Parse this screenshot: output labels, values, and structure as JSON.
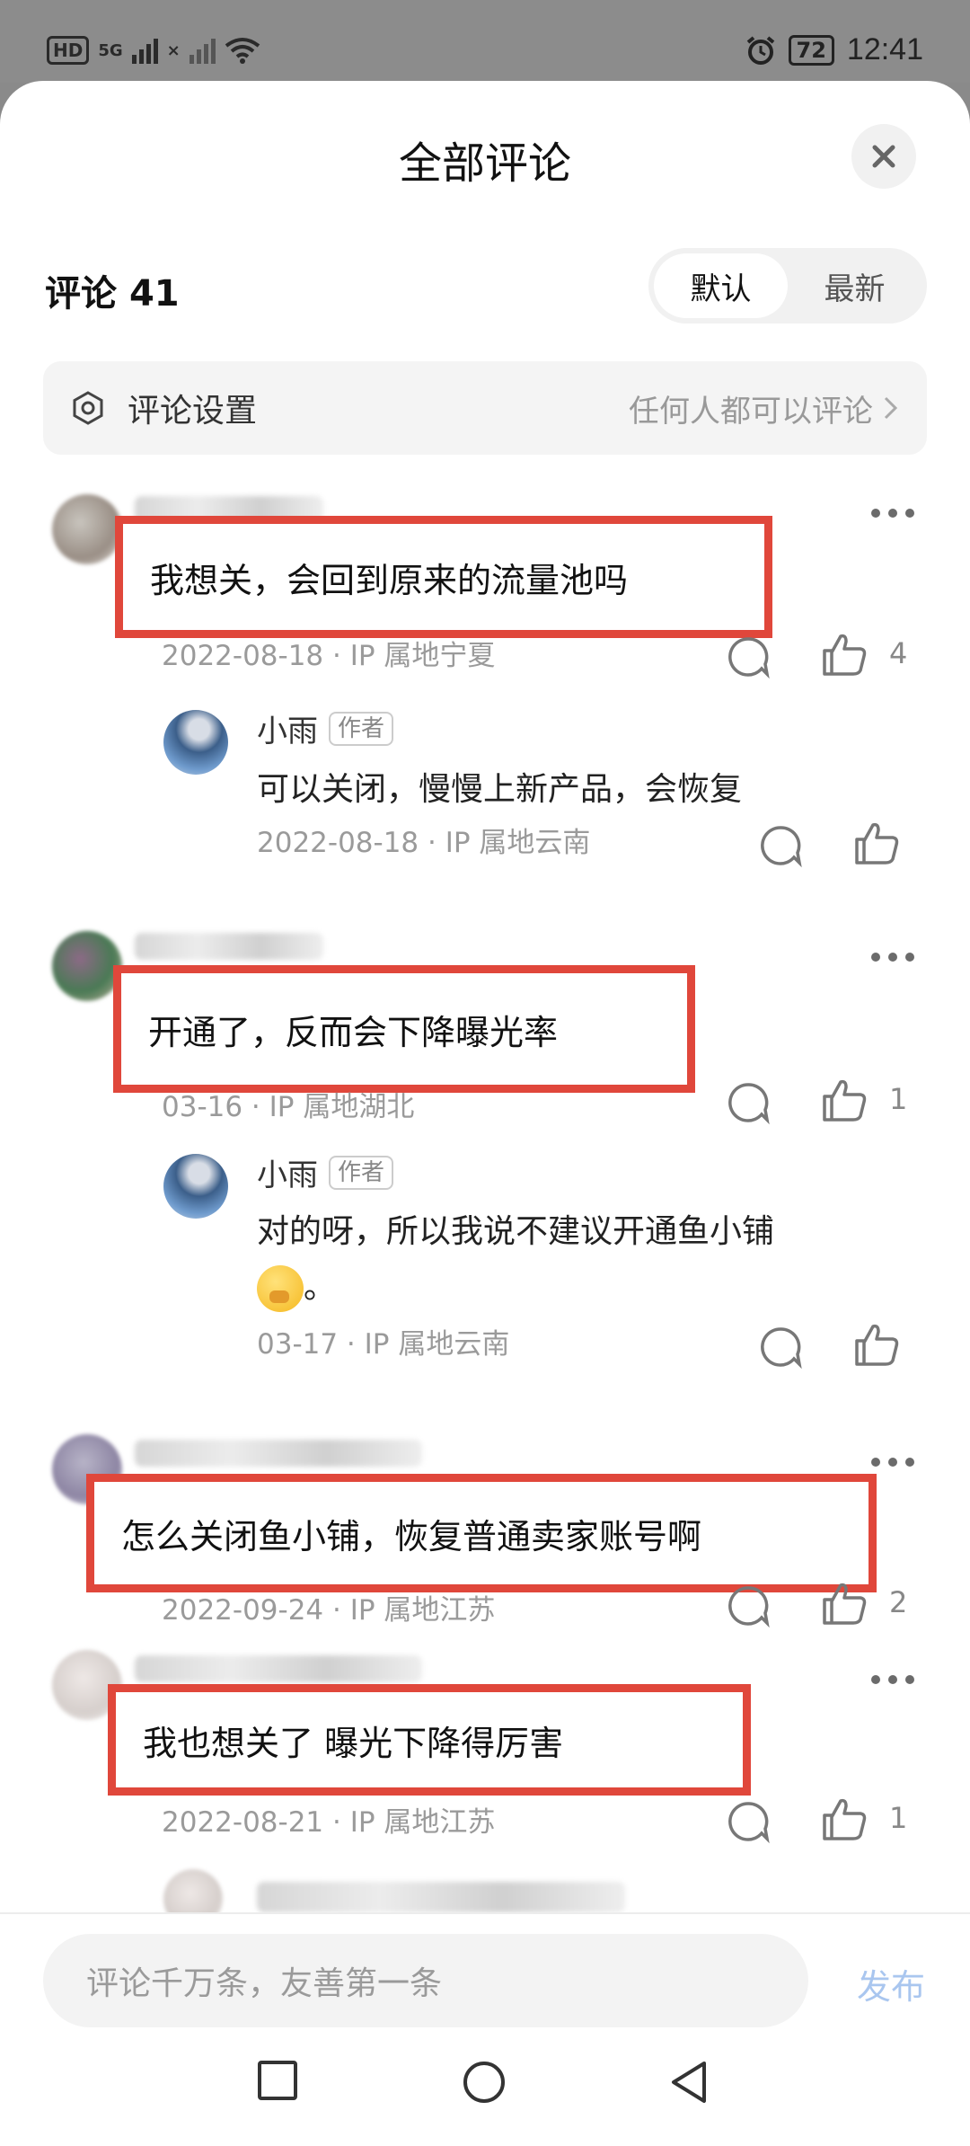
{
  "status_bar": {
    "network_badge": "HD",
    "signal_labels": [
      "5G",
      "×"
    ],
    "battery": "72",
    "time": "12:41",
    "icons": [
      "alarm-icon",
      "wifi-icon",
      "signal-icon",
      "battery-icon"
    ]
  },
  "sheet": {
    "title": "全部评论",
    "close_icon": "close-icon"
  },
  "comments_header": {
    "label": "评论",
    "count": "41",
    "sort_options": [
      "默认",
      "最新"
    ],
    "active_sort": "默认"
  },
  "settings_row": {
    "label": "评论设置",
    "value": "任何人都可以评论",
    "icon": "settings-icon"
  },
  "comments": [
    {
      "text": "我想关，会回到原来的流量池吗",
      "meta": "2022-08-18 · IP 属地宁夏",
      "likes": "4",
      "reply": {
        "author": "小雨",
        "tag": "作者",
        "text": "可以关闭，慢慢上新产品，会恢复",
        "meta": "2022-08-18 · IP 属地云南"
      }
    },
    {
      "text": "开通了，反而会下降曝光率",
      "meta": "03-16 · IP 属地湖北",
      "likes": "1",
      "reply": {
        "author": "小雨",
        "tag": "作者",
        "text": "对的呀，所以我说不建议开通鱼小铺",
        "text_tail": "。",
        "meta": "03-17 · IP 属地云南"
      }
    },
    {
      "text": "怎么关闭鱼小铺，恢复普通卖家账号啊",
      "meta": "2022-09-24 · IP 属地江苏",
      "likes": "2"
    },
    {
      "text": "我也想关了 曝光下降得厉害",
      "meta": "2022-08-21 · IP 属地江苏",
      "likes": "1"
    }
  ],
  "input_bar": {
    "placeholder": "评论千万条，友善第一条",
    "publish_label": "发布"
  },
  "nav_bar": {
    "buttons": [
      "recent-apps-icon",
      "home-icon",
      "back-icon"
    ]
  },
  "colors": {
    "highlight_border": "#e0473b",
    "publish_disabled": "#a9c6ef",
    "meta_gray": "#9a9a9a"
  }
}
